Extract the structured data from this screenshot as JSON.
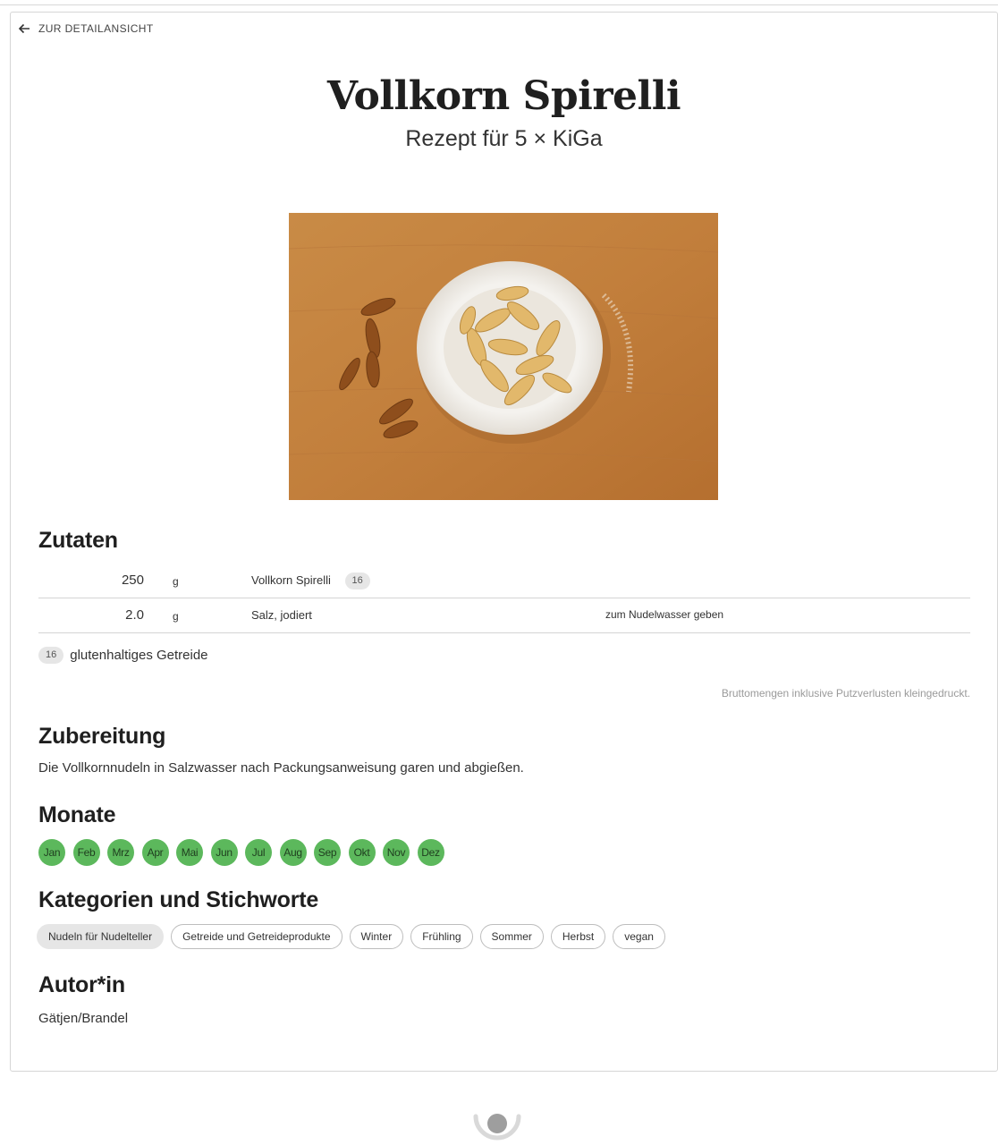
{
  "nav": {
    "back_label": "ZUR DETAILANSICHT"
  },
  "recipe": {
    "title": "Vollkorn Spirelli",
    "subtitle": "Rezept für 5 × KiGa"
  },
  "ingredients": {
    "heading": "Zutaten",
    "rows": [
      {
        "amount": "250",
        "unit": "g",
        "name": "Vollkorn Spirelli",
        "badge": "16",
        "note": ""
      },
      {
        "amount": "2.0",
        "unit": "g",
        "name": "Salz, jodiert",
        "badge": "",
        "note": "zum Nudelwasser geben"
      }
    ],
    "allergen": {
      "code": "16",
      "label": "glutenhaltiges Getreide"
    },
    "footnote": "Bruttomengen inklusive Putzverlusten kleingedruckt."
  },
  "preparation": {
    "heading": "Zubereitung",
    "text": "Die Vollkornnudeln in Salzwasser nach Packungsanweisung garen und abgießen."
  },
  "months": {
    "heading": "Monate",
    "items": [
      "Jan",
      "Feb",
      "Mrz",
      "Apr",
      "Mai",
      "Jun",
      "Jul",
      "Aug",
      "Sep",
      "Okt",
      "Nov",
      "Dez"
    ],
    "color": "#5cb85c"
  },
  "categories": {
    "heading": "Kategorien und Stichworte",
    "items": [
      "Nudeln für Nudelteller",
      "Getreide und Getreideprodukte",
      "Winter",
      "Frühling",
      "Sommer",
      "Herbst",
      "vegan"
    ]
  },
  "author": {
    "heading": "Autor*in",
    "name": "Gätjen/Brandel"
  },
  "icons": {
    "back": "arrow-left-icon",
    "loading": "loading-spinner-icon"
  }
}
